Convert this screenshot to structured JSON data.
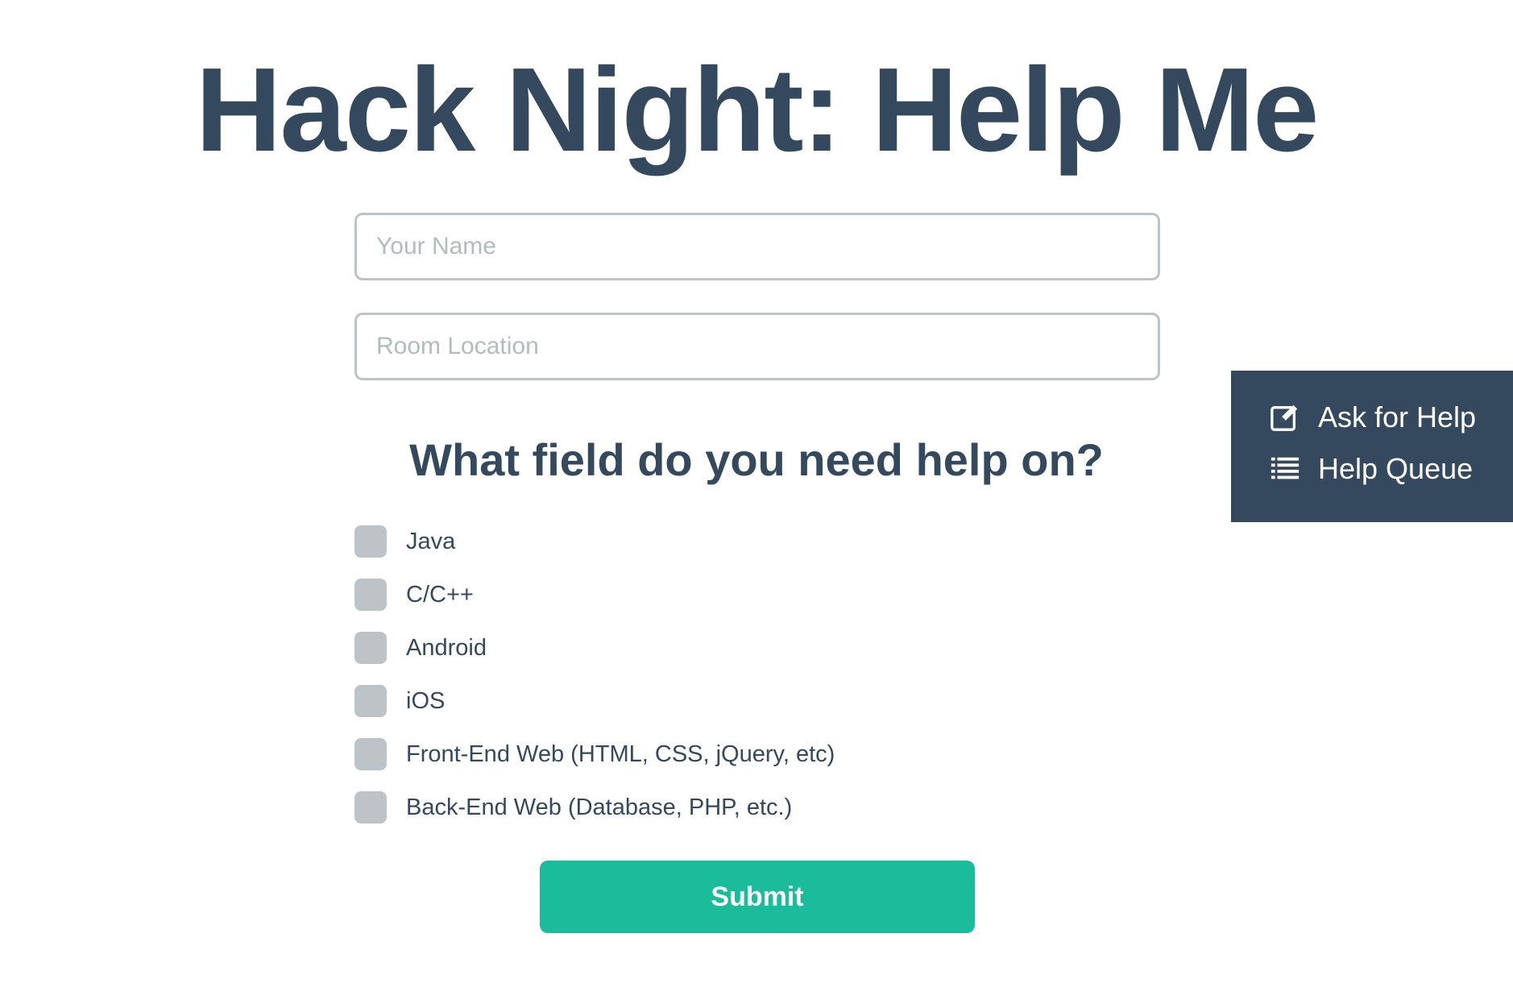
{
  "header": {
    "title": "Hack Night: Help Me"
  },
  "form": {
    "name_placeholder": "Your Name",
    "room_placeholder": "Room Location",
    "question": "What field do you need help on?",
    "options": [
      {
        "label": "Java",
        "checked": false
      },
      {
        "label": "C/C++",
        "checked": false
      },
      {
        "label": "Android",
        "checked": false
      },
      {
        "label": "iOS",
        "checked": false
      },
      {
        "label": "Front-End Web (HTML, CSS, jQuery, etc)",
        "checked": false
      },
      {
        "label": "Back-End Web (Database, PHP, etc.)",
        "checked": false
      }
    ],
    "submit_label": "Submit"
  },
  "side_nav": {
    "items": [
      {
        "label": "Ask for Help",
        "icon": "edit-icon"
      },
      {
        "label": "Help Queue",
        "icon": "list-icon"
      }
    ]
  },
  "colors": {
    "primary_text": "#34495e",
    "accent": "#1abc9c",
    "control_gray": "#bdc3c7",
    "nav_background": "#34495e"
  }
}
